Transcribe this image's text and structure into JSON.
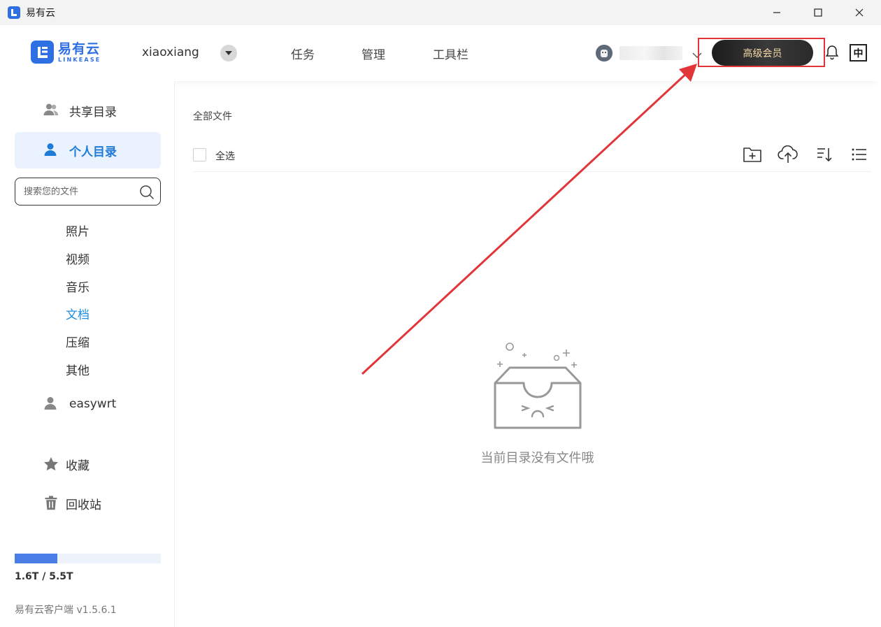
{
  "window": {
    "title": "易有云",
    "controls": [
      "minimize-icon",
      "maximize-icon",
      "close-icon"
    ]
  },
  "header": {
    "logo": {
      "cn": "易有云",
      "en": "LINKEASE"
    },
    "user": {
      "name": "xiaoxiang"
    },
    "nav": [
      {
        "label": "任务"
      },
      {
        "label": "管理"
      },
      {
        "label": "工具栏"
      }
    ],
    "vip_label": "高级会员",
    "lang_label": "中"
  },
  "sidebar": {
    "shared_label": "共享目录",
    "personal_label": "个人目录",
    "search_placeholder": "搜索您的文件",
    "categories": [
      {
        "label": "照片"
      },
      {
        "label": "视频"
      },
      {
        "label": "音乐"
      },
      {
        "label": "文档",
        "active": true
      },
      {
        "label": "压缩"
      },
      {
        "label": "其他"
      }
    ],
    "device_label": "easywrt",
    "favorites_label": "收藏",
    "recycle_label": "回收站",
    "storage": {
      "used": "1.6T",
      "total": "5.5T",
      "text": "1.6T / 5.5T",
      "used_fraction": 0.29
    },
    "version": "易有云客户端 v1.5.6.1"
  },
  "main": {
    "breadcrumb": "全部文件",
    "select_all_label": "全选",
    "tools": [
      "new-folder-icon",
      "upload-cloud-icon",
      "sort-icon",
      "list-view-icon"
    ],
    "empty_text": "当前目录没有文件哦"
  },
  "colors": {
    "brand": "#2f6fe4",
    "active_text": "#1e7bd8",
    "annotation": "#e2353a",
    "vip_text": "#f4d9a8"
  }
}
